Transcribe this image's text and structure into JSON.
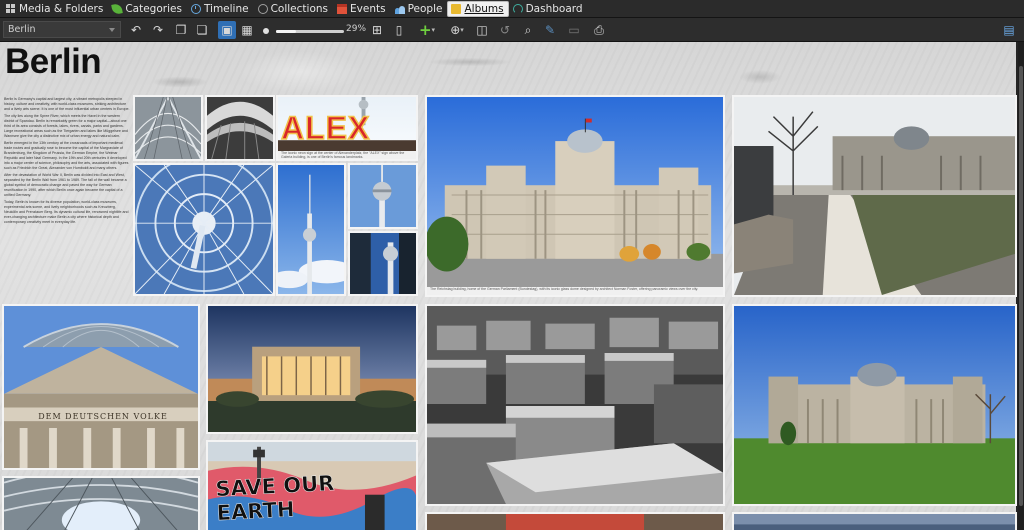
{
  "tabs": [
    {
      "label": "Media & Folders",
      "icon": "media-folders-icon"
    },
    {
      "label": "Categories",
      "icon": "categories-icon"
    },
    {
      "label": "Timeline",
      "icon": "timeline-icon"
    },
    {
      "label": "Collections",
      "icon": "collections-icon"
    },
    {
      "label": "Events",
      "icon": "events-icon"
    },
    {
      "label": "People",
      "icon": "people-icon"
    },
    {
      "label": "Albums",
      "icon": "albums-icon",
      "active": true
    },
    {
      "label": "Dashboard",
      "icon": "dashboard-icon"
    }
  ],
  "toolbar": {
    "album_select_value": "Berlin",
    "zoom_label": "29%",
    "zoom_fraction": 0.29,
    "buttons": [
      "undo-icon",
      "redo-icon",
      "copy-icon",
      "paste-icon",
      "page-view-icon",
      "grid-view-icon",
      "fit-page-icon",
      "single-page-icon",
      "add-icon",
      "layout-icon",
      "columns-icon",
      "rotate-icon",
      "search-icon",
      "pen-icon",
      "film-strip-icon",
      "print-icon",
      "document-icon"
    ]
  },
  "album": {
    "title": "Berlin",
    "intro_paragraphs": [
      "Berlin is Germany's capital and largest city, a vibrant metropolis steeped in history, culture and creativity, with world-class museums, striking architecture and a lively arts scene. It is one of the most influential urban centers in Europe.",
      "The city lies along the Spree River, which meets the Havel in the western district of Spandau. Berlin is remarkably green for a major capital—about one third of its area consists of forests, lakes, rivers, canals, parks and gardens. Large recreational areas such as the Tiergarten and lakes like Müggelsee and Wannsee give the city a distinctive mix of urban energy and natural calm.",
      "Berlin emerged in the 13th century at the crossroads of important medieval trade routes and gradually rose to become the capital of the Margraviate of Brandenburg, the Kingdom of Prussia, the German Empire, the Weimar Republic and later Nazi Germany. In the 19th and 20th centuries it developed into a major center of science, philosophy and the arts, associated with figures such as Friedrich the Great, Alexander von Humboldt and many others.",
      "After the devastation of World War II, Berlin was divided into East and West, separated by the Berlin Wall from 1961 to 1989. The fall of the wall became a global symbol of democratic change and paved the way for German reunification in 1990, after which Berlin once again became the capital of a unified Germany.",
      "Today, Berlin is known for its diverse population, world-class museums, experimental arts scene, and lively neighborhoods such as Kreuzberg, Neukölln and Prenzlauer Berg. Its dynamic cultural life, renowned nightlife and ever-changing architecture make Berlin a city where historical depth and contemporary creativity meet in everyday life."
    ],
    "captions": {
      "alex": "The iconic neon sign at the center of Alexanderplatz, the \"ALEX\" sign above the Galeria building, is one of Berlin's famous landmarks.",
      "reichstag_main": "The Reichstag building, home of the German Parliament (Bundestag), with its iconic glass dome designed by architect Norman Foster, offering panoramic views over the city."
    },
    "sign_text": "ALEX",
    "frieze_text": "DEM DEUTSCHEN VOLKE",
    "graffiti_text": "SAVE OUR EARTH"
  },
  "colors": {
    "active_tab_bg": "#f0f0f0",
    "toolbar_active": "#2f6fb5",
    "page_bg": "#dcdcdc"
  }
}
